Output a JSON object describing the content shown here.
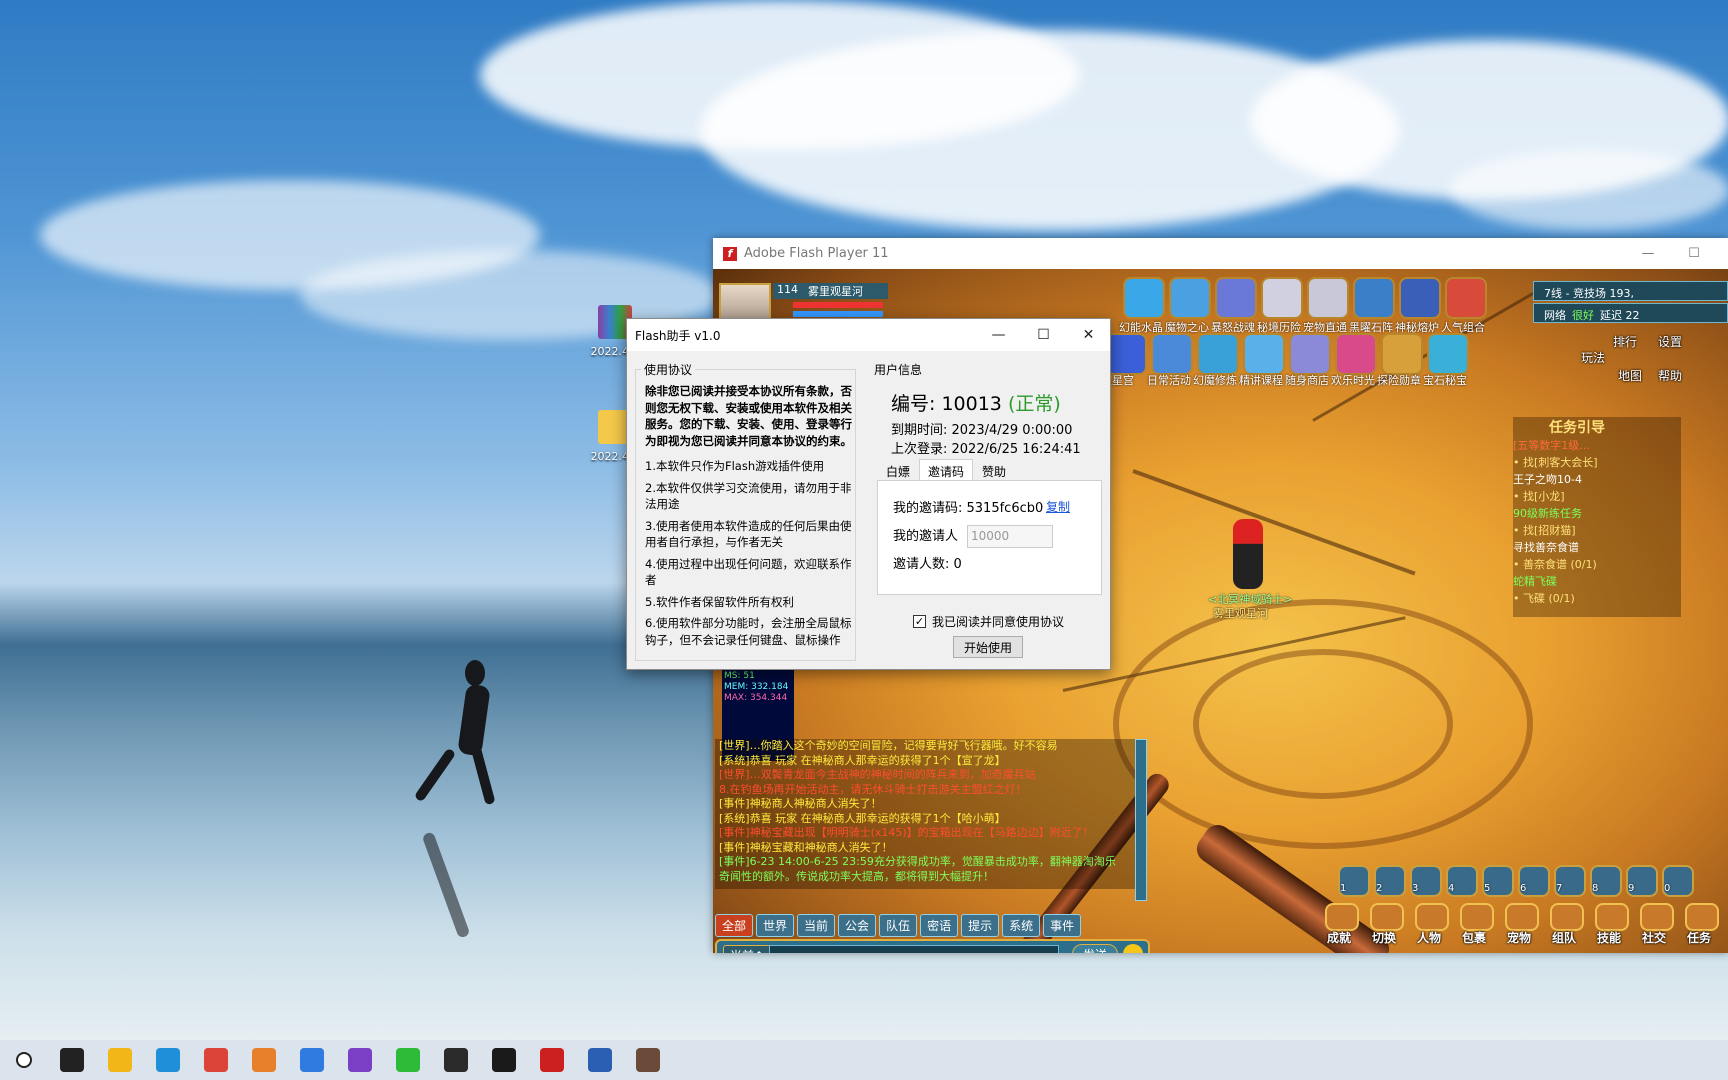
{
  "desktop": {
    "icons": [
      {
        "label": "2022.4..."
      },
      {
        "label": "2022.4..."
      }
    ]
  },
  "flash_window": {
    "title": "Adobe Flash Player 11",
    "logo_glyph": "f",
    "minimize": "—",
    "maximize": "☐"
  },
  "game": {
    "player_level": "114",
    "player_name": "雾里观星河",
    "server": "7线 - 竞技场 193,",
    "network_label": "网络",
    "network_status": "很好",
    "latency_label": "延迟 22",
    "fps_lines": [
      "MS: 51",
      "MEM: 332.184",
      "MAX: 354.344"
    ],
    "top_skills": [
      "幻能水晶",
      "魔物之心",
      "暴怒战魂",
      "秘境历险",
      "宠物直通",
      "黑曜石阵",
      "神秘熔炉",
      "人气组合"
    ],
    "second_row": [
      "炫星宫",
      "日常活动",
      "幻魔修炼",
      "精讲课程",
      "随身商店",
      "欢乐时光",
      "探险勋章",
      "宝石秘宝"
    ],
    "right_buttons": [
      "排行",
      "设置",
      "玩法",
      "地图",
      "帮助"
    ],
    "task_title": "任务引导",
    "task_lines": [
      {
        "text": "[五等数字1级...",
        "color": "#ff6a3a"
      },
      {
        "text": "• 找[刺客大会长]",
        "color": "#ffe07a"
      },
      {
        "text": "王子之吻10-4",
        "color": "#ffffff"
      },
      {
        "text": "• 找[小龙]",
        "color": "#ffe07a"
      },
      {
        "text": "90级新练任务",
        "color": "#7dff5a"
      },
      {
        "text": "• 找[招财猫]",
        "color": "#ffe07a"
      },
      {
        "text": "寻找善奈食谱",
        "color": "#ffffff"
      },
      {
        "text": "• 善奈食谱 (0/1)",
        "color": "#ffe07a"
      },
      {
        "text": "蛇精飞碟",
        "color": "#7dff5a"
      },
      {
        "text": "• 飞碟 (0/1)",
        "color": "#ffe07a"
      }
    ],
    "npc_name": "雾里观星河",
    "npc_title": "<北冥神域骑士>",
    "chat_lines": [
      {
        "text": "[世界]…你踏入这个奇妙的空间冒险，记得要背好飞行器哦。好不容易",
        "color": "#ffeb3b"
      },
      {
        "text": "[系统]恭喜 玩家 在神秘商人那幸运的获得了1个【宣了龙】",
        "color": "#ffeb3b"
      },
      {
        "text": "[世界]…双鬓青龙面今主战神的神秘时间的阵兵来到，加奇魔兵站",
        "color": "#ff4d2e"
      },
      {
        "text": "8.在钓鱼场再开始活动主，请无休斗骑士打击游关主盟红之灯！",
        "color": "#ff4d2e"
      },
      {
        "text": "[事件]神秘商人神秘商人消失了！",
        "color": "#ffeb3b"
      },
      {
        "text": "[系统]恭喜 玩家 在神秘商人那幸运的获得了1个【哈小萌】",
        "color": "#ffeb3b"
      },
      {
        "text": "[事件]神秘宝藏出现【明明骑士(x145)】的宝箱出现在【马路边边】附近了！",
        "color": "#ff4d2e"
      },
      {
        "text": "[事件]神秘宝藏和神秘商人消失了！",
        "color": "#ffeb3b"
      },
      {
        "text": "[事件]6-23 14:00-6-25 23:59充分获得成功率，觉醒暴击成功率，翻神器淘淘乐",
        "color": "#7dff5a"
      },
      {
        "text": "奇闻性的额外。传说成功率大提高，都将得到大幅提升！",
        "color": "#7dff5a"
      }
    ],
    "chat_tabs": [
      "全部",
      "世界",
      "当前",
      "公会",
      "队伍",
      "密语",
      "提示",
      "系统",
      "事件"
    ],
    "chat_channel": "当前↑",
    "send_label": "发送",
    "bottom_buttons": [
      "成就",
      "切换",
      "人物",
      "包裹",
      "宠物",
      "组队",
      "技能",
      "社交",
      "任务"
    ],
    "hotbar_numbers": [
      "1",
      "2",
      "3",
      "4",
      "5",
      "6",
      "7",
      "8",
      "9",
      "0"
    ]
  },
  "dialog": {
    "title": "Flash助手 v1.0",
    "minimize": "—",
    "maximize": "☐",
    "close": "✕",
    "agreement": {
      "legend": "使用协议",
      "intro": "除非您已阅读并接受本协议所有条款，否则您无权下载、安装或使用本软件及相关服务。您的下载、安装、使用、登录等行为即视为您已阅读并同意本协议的约束。",
      "items": [
        "1.本软件只作为Flash游戏插件使用",
        "2.本软件仅供学习交流使用，请勿用于非法用途",
        "3.使用者使用本软件造成的任何后果由使用者自行承担，与作者无关",
        "4.使用过程中出现任何问题，欢迎联系作者",
        "5.软件作者保留软件所有权利",
        "6.使用软件部分功能时，会注册全局鼠标钩子，但不会记录任何键盘、鼠标操作"
      ]
    },
    "user_info": {
      "legend": "用户信息",
      "id_label": "编号: 10013",
      "status": "(正常)",
      "expire": "到期时间: 2023/4/29 0:00:00",
      "last_login": "上次登录: 2022/6/25 16:24:41",
      "tabs": [
        "白嫖",
        "邀请码",
        "赞助"
      ],
      "active_tab": "邀请码",
      "my_code_label": "我的邀请码: 5315fc6cb0",
      "copy_label": "复制",
      "inviter_label": "我的邀请人",
      "inviter_placeholder": "10000",
      "invite_count_label": "邀请人数: 0"
    },
    "agree_label": "我已阅读并同意使用协议",
    "agree_checked": true,
    "start_button": "开始使用"
  },
  "taskbar": {
    "items": [
      {
        "icon": "search-icon",
        "color": "#ffffff"
      },
      {
        "icon": "task-view-icon",
        "color": "#222222"
      },
      {
        "icon": "file-explorer-icon",
        "color": "#f2b619"
      },
      {
        "icon": "edge-icon",
        "color": "#1e8fd8"
      },
      {
        "icon": "chrome-icon",
        "color": "#db4437"
      },
      {
        "icon": "paint-icon",
        "color": "#e87f2a"
      },
      {
        "icon": "maps-icon",
        "color": "#2f7be0"
      },
      {
        "icon": "visual-studio-icon",
        "color": "#7a3fc5"
      },
      {
        "icon": "wechat-icon",
        "color": "#2dbb38"
      },
      {
        "icon": "obs-icon",
        "color": "#2a2a2a"
      },
      {
        "icon": "qq-icon",
        "color": "#1a1a1a"
      },
      {
        "icon": "flash-icon",
        "color": "#cc1f1f"
      },
      {
        "icon": "word-icon",
        "color": "#2b5fb3"
      },
      {
        "icon": "game-avatar-icon",
        "color": "#6b4a3a"
      }
    ]
  }
}
